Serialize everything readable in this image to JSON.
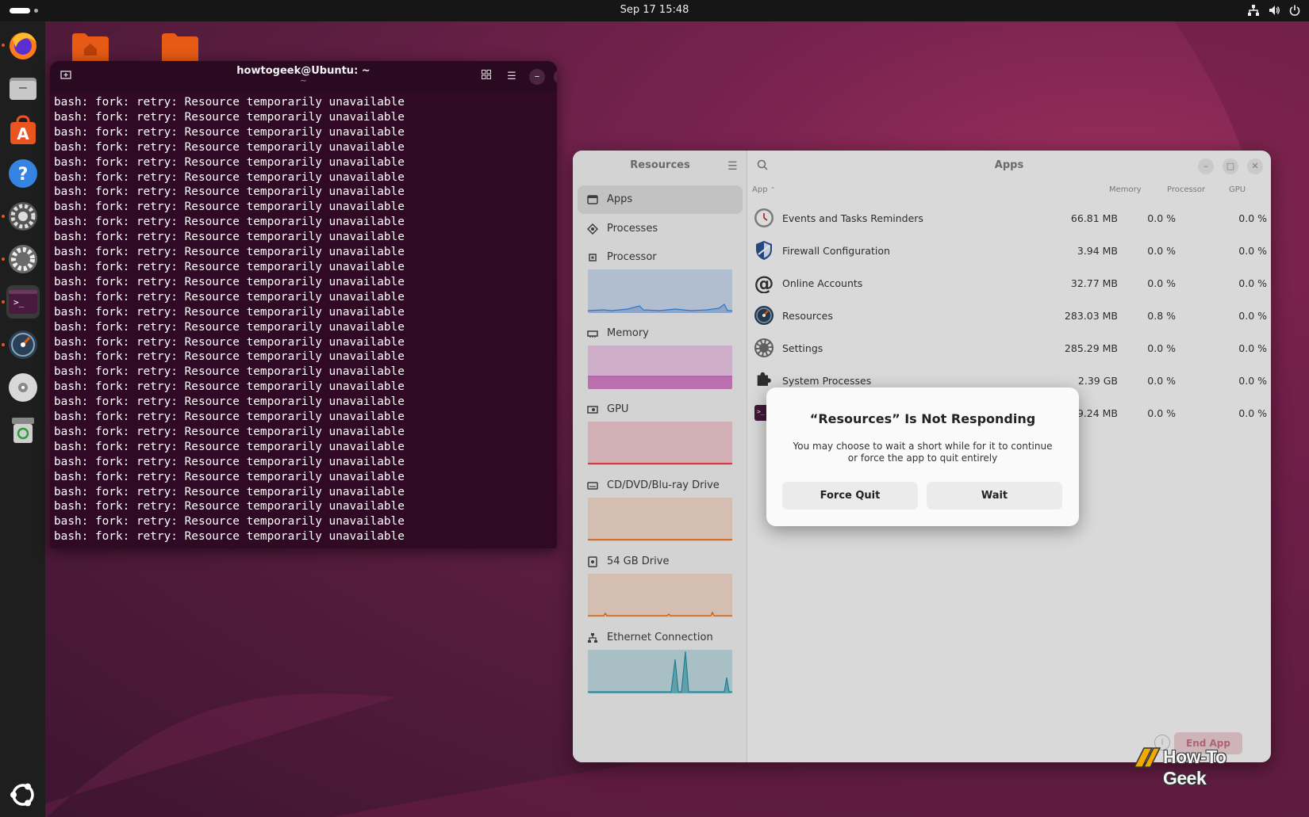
{
  "topbar": {
    "clock": "Sep 17  15:48"
  },
  "dock": {
    "items": [
      "firefox-icon",
      "files-icon",
      "app-center-icon",
      "help-icon",
      "settings-icon",
      "settings-icon-2",
      "terminal-icon",
      "resources-icon",
      "disc-icon",
      "trash-icon"
    ],
    "apps_grid": "ubuntu-apps-icon"
  },
  "terminal": {
    "title": "howtogeek@Ubuntu: ~",
    "subtitle": "~",
    "line": "bash: fork: retry: Resource temporarily unavailable",
    "line_count": 30
  },
  "resources": {
    "sidebar_title": "Resources",
    "main_title": "Apps",
    "sidebar": [
      {
        "label": "Apps"
      },
      {
        "label": "Processes"
      },
      {
        "label": "Processor"
      },
      {
        "label": "Memory"
      },
      {
        "label": "GPU"
      },
      {
        "label": "CD/DVD/Blu-ray Drive"
      },
      {
        "label": "54 GB Drive"
      },
      {
        "label": "Ethernet Connection"
      }
    ],
    "columns": {
      "app": "App",
      "memory": "Memory",
      "processor": "Processor",
      "gpu": "GPU"
    },
    "apps": [
      {
        "name": "Events and Tasks Reminders",
        "memory": "66.81 MB",
        "processor": "0.0 %",
        "gpu": "0.0 %"
      },
      {
        "name": "Firewall Configuration",
        "memory": "3.94 MB",
        "processor": "0.0 %",
        "gpu": "0.0 %"
      },
      {
        "name": "Online Accounts",
        "memory": "32.77 MB",
        "processor": "0.0 %",
        "gpu": "0.0 %"
      },
      {
        "name": "Resources",
        "memory": "283.03 MB",
        "processor": "0.8 %",
        "gpu": "0.0 %"
      },
      {
        "name": "Settings",
        "memory": "285.29 MB",
        "processor": "0.0 %",
        "gpu": "0.0 %"
      },
      {
        "name": "System Processes",
        "memory": "2.39 GB",
        "processor": "0.0 %",
        "gpu": "0.0 %"
      },
      {
        "name": "",
        "memory": "249.24 MB",
        "processor": "0.0 %",
        "gpu": "0.0 %"
      }
    ],
    "end_app": "End App",
    "colors": {
      "processor": "#3584e4",
      "memory": "#c061cb",
      "gpu": "#e01b24",
      "cd_drive": "#e66100",
      "drive": "#e66100",
      "ethernet": "#2190a4"
    }
  },
  "dialog": {
    "title": "“Resources” Is Not Responding",
    "body": "You may choose to wait a short while for it to continue or force the app to quit entirely",
    "force_quit": "Force Quit",
    "wait": "Wait"
  },
  "watermark": {
    "text": "How-To Geek"
  }
}
